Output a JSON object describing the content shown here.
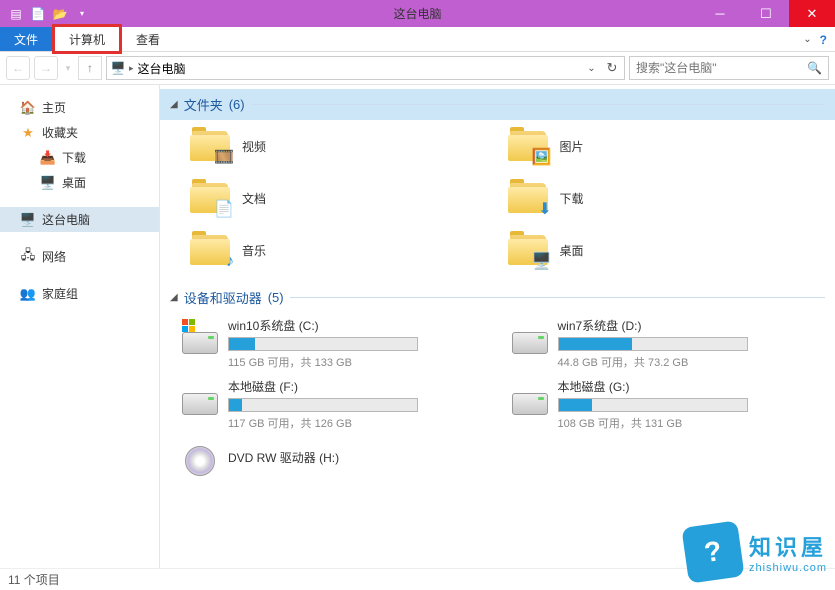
{
  "window": {
    "title": "这台电脑"
  },
  "tabs": {
    "file": "文件",
    "computer": "计算机",
    "view": "查看"
  },
  "nav": {
    "location": "这台电脑",
    "search_placeholder": "搜索\"这台电脑\""
  },
  "sidebar": {
    "home": "主页",
    "favorites": "收藏夹",
    "downloads": "下载",
    "desktop": "桌面",
    "this_pc": "这台电脑",
    "network": "网络",
    "homegroup": "家庭组"
  },
  "groups": {
    "folders": {
      "label": "文件夹",
      "count": "(6)"
    },
    "devices": {
      "label": "设备和驱动器",
      "count": "(5)"
    }
  },
  "folders": [
    {
      "name": "视频"
    },
    {
      "name": "图片"
    },
    {
      "name": "文档"
    },
    {
      "name": "下载"
    },
    {
      "name": "音乐"
    },
    {
      "name": "桌面"
    }
  ],
  "drives": [
    {
      "name": "win10系统盘 (C:)",
      "free": "115 GB 可用，共 133 GB",
      "fill": 14,
      "os": true
    },
    {
      "name": "win7系统盘 (D:)",
      "free": "44.8 GB 可用，共 73.2 GB",
      "fill": 39,
      "os": false
    },
    {
      "name": "本地磁盘 (F:)",
      "free": "117 GB 可用，共 126 GB",
      "fill": 7,
      "os": false
    },
    {
      "name": "本地磁盘 (G:)",
      "free": "108 GB 可用，共 131 GB",
      "fill": 18,
      "os": false
    }
  ],
  "dvd": {
    "name": "DVD RW 驱动器 (H:)"
  },
  "status": {
    "items": "11 个项目"
  },
  "watermark": {
    "brand": "知识屋",
    "url": "zhishiwu.com"
  }
}
